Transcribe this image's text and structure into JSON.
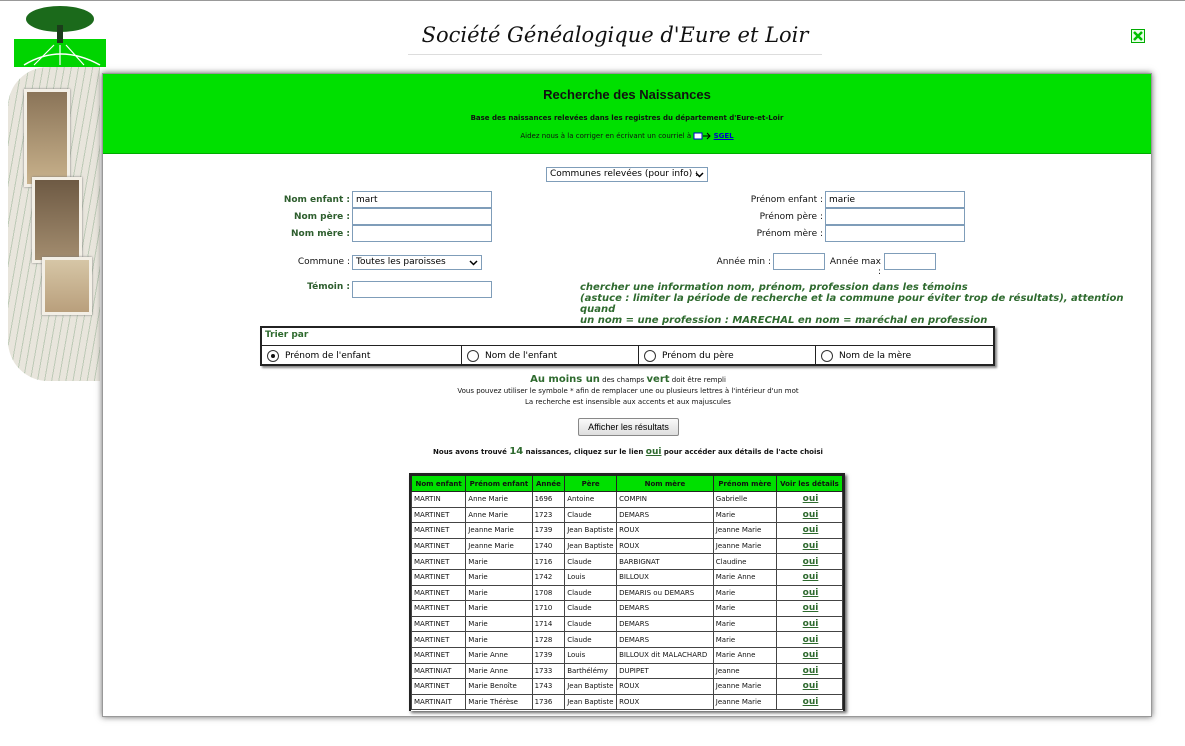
{
  "header": {
    "site_title": "Société Généalogique d'Eure et Loir"
  },
  "banner": {
    "title": "Recherche des Naissances",
    "subtitle": "Base des naissances relevées dans les registres du département d'Eure-et-Loir",
    "help_text": "Aidez nous à la corriger en écrivant un courriel à",
    "help_link": "SGEL"
  },
  "communes_select": {
    "value": "Communes relevées (pour info) :"
  },
  "form": {
    "nom_enfant": {
      "label": "Nom enfant :",
      "value": "mart"
    },
    "nom_pere": {
      "label": "Nom père :",
      "value": ""
    },
    "nom_mere": {
      "label": "Nom mère :",
      "value": ""
    },
    "prenom_enfant": {
      "label": "Prénom enfant :",
      "value": "marie"
    },
    "prenom_pere": {
      "label": "Prénom père :",
      "value": ""
    },
    "prenom_mere": {
      "label": "Prénom mère :",
      "value": ""
    },
    "commune": {
      "label": "Commune :",
      "value": "Toutes les paroisses"
    },
    "annee_min": {
      "label": "Année min :",
      "value": ""
    },
    "annee_max": {
      "label": "Année max :",
      "value": ""
    },
    "temoin": {
      "label": "Témoin :",
      "value": ""
    },
    "hint_line1": "chercher une information nom, prénom, profession dans les témoins",
    "hint_line2": "(astuce : limiter la période de recherche et la commune pour éviter trop de résultats), attention quand",
    "hint_line3": "un nom = une profession : MARECHAL en nom = maréchal en profession"
  },
  "sort": {
    "title": "Trier par",
    "options": [
      "Prénom de l'enfant",
      "Nom de l'enfant",
      "Prénom du père",
      "Nom de la mère"
    ],
    "selected": 0
  },
  "notes": {
    "line1_big": "Au moins un",
    "line1_mid": "des champs",
    "line1_big2": "vert",
    "line1_end": "doit être rempli",
    "line2": "Vous pouvez utiliser le symbole * afin de remplacer une ou plusieurs lettres à l'intérieur d'un mot",
    "line3": "La recherche est insensible aux accents et aux majuscules"
  },
  "submit_label": "Afficher les résultats",
  "found": {
    "prefix": "Nous avons trouvé",
    "count": "14",
    "middle": "naissances, cliquez sur le lien",
    "link": "oui",
    "suffix": "pour accéder aux détails de l'acte choisi"
  },
  "table": {
    "headers": [
      "Nom enfant",
      "Prénom enfant",
      "Année",
      "Père",
      "Nom mère",
      "Prénom mère",
      "Voir les détails"
    ],
    "rows": [
      [
        "MARTIN",
        "Anne Marie",
        "1696",
        "Antoine",
        "COMPIN",
        "Gabrielle",
        "oui"
      ],
      [
        "MARTINET",
        "Anne Marie",
        "1723",
        "Claude",
        "DEMARS",
        "Marie",
        "oui"
      ],
      [
        "MARTINET",
        "Jeanne Marie",
        "1739",
        "Jean Baptiste",
        "ROUX",
        "Jeanne Marie",
        "oui"
      ],
      [
        "MARTINET",
        "Jeanne Marie",
        "1740",
        "Jean Baptiste",
        "ROUX",
        "Jeanne Marie",
        "oui"
      ],
      [
        "MARTINET",
        "Marie",
        "1716",
        "Claude",
        "BARBIGNAT",
        "Claudine",
        "oui"
      ],
      [
        "MARTINET",
        "Marie",
        "1742",
        "Louis",
        "BILLOUX",
        "Marie Anne",
        "oui"
      ],
      [
        "MARTINET",
        "Marie",
        "1708",
        "Claude",
        "DEMARIS ou DEMARS",
        "Marie",
        "oui"
      ],
      [
        "MARTINET",
        "Marie",
        "1710",
        "Claude",
        "DEMARS",
        "Marie",
        "oui"
      ],
      [
        "MARTINET",
        "Marie",
        "1714",
        "Claude",
        "DEMARS",
        "Marie",
        "oui"
      ],
      [
        "MARTINET",
        "Marie",
        "1728",
        "Claude",
        "DEMARS",
        "Marie",
        "oui"
      ],
      [
        "MARTINET",
        "Marie Anne",
        "1739",
        "Louis",
        "BILLOUX dit MALACHARD",
        "Marie Anne",
        "oui"
      ],
      [
        "MARTINIAT",
        "Marie Anne",
        "1733",
        "Barthélémy",
        "DUPIPET",
        "Jeanne",
        "oui"
      ],
      [
        "MARTINET",
        "Marie Benoîte",
        "1743",
        "Jean Baptiste",
        "ROUX",
        "Jeanne Marie",
        "oui"
      ],
      [
        "MARTINAIT",
        "Marie Thérèse",
        "1736",
        "Jean Baptiste",
        "ROUX",
        "Jeanne Marie",
        "oui"
      ]
    ]
  }
}
